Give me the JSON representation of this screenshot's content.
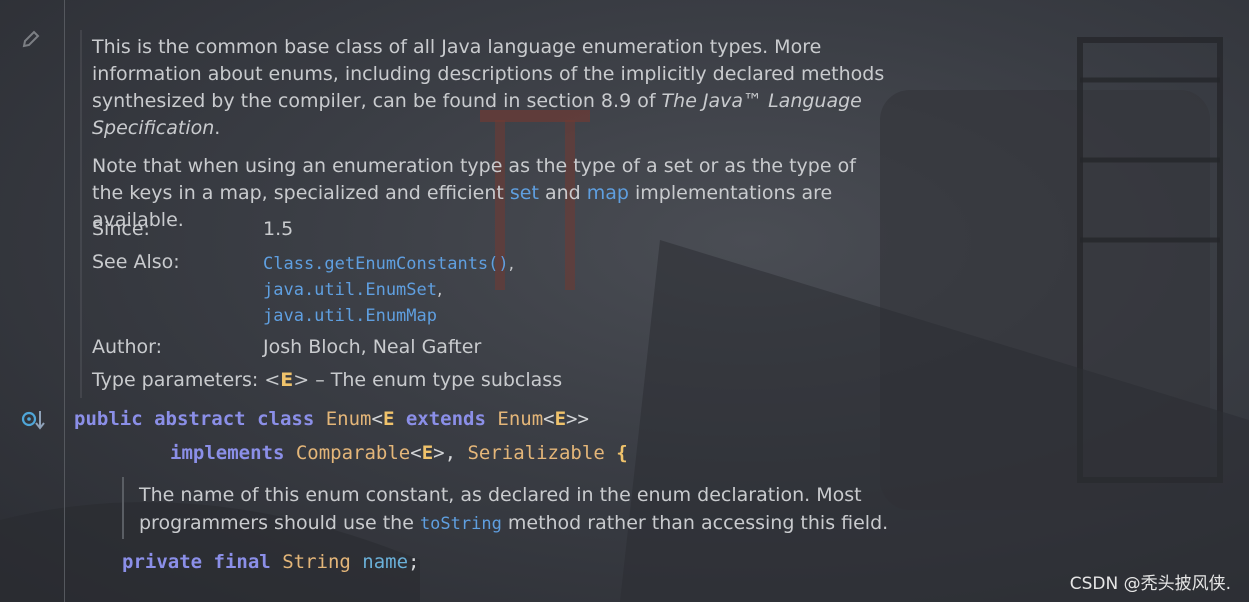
{
  "doc": {
    "p1_a": "This is the common base class of all Java language enumeration types. More information about enums, including descriptions of the implicitly declared methods synthesized by the compiler, can be found in section 8.9 of ",
    "p1_em": "The Java™ Language Specification",
    "p1_end": ".",
    "p2_a": "Note that when using an enumeration type as the type of a set or as the type of the keys in a map, specialized and efficient ",
    "p2_link1": "set",
    "p2_mid": " and ",
    "p2_link2": "map",
    "p2_end": " implementations are available.",
    "since_label": "Since:",
    "since_value": "1.5",
    "see_also_label": "See Also:",
    "see_also": [
      "Class.getEnumConstants()",
      "java.util.EnumSet",
      "java.util.EnumMap"
    ],
    "see_sep": ",",
    "author_label": "Author:",
    "author_value": "Josh Bloch, Neal Gafter",
    "type_params_label": "Type parameters:",
    "type_param_open": "<",
    "type_param_name": "E",
    "type_param_close": ">",
    "type_param_desc": " – The enum type subclass"
  },
  "code": {
    "line1": {
      "public": "public",
      "abstract": "abstract",
      "class": "class",
      "name": "Enum",
      "lt": "<",
      "E": "E",
      "extends": "extends",
      "super": "Enum",
      "lt2": "<",
      "E2": "E",
      "gt": ">>"
    },
    "line2": {
      "implements": "implements",
      "comparable": "Comparable",
      "lt": "<",
      "E": "E",
      "gt": ">",
      "comma": ", ",
      "serializable": "Serializable",
      "brace": " {"
    },
    "field": {
      "private": "private",
      "final": "final",
      "type": "String",
      "name": "name",
      "semi": ";"
    }
  },
  "field_doc": {
    "a": "The name of this enum constant, as declared in the enum declaration. Most programmers should use the ",
    "link": "toString",
    "b": " method rather than accessing this field."
  },
  "watermark": "CSDN @秃头披风侠."
}
